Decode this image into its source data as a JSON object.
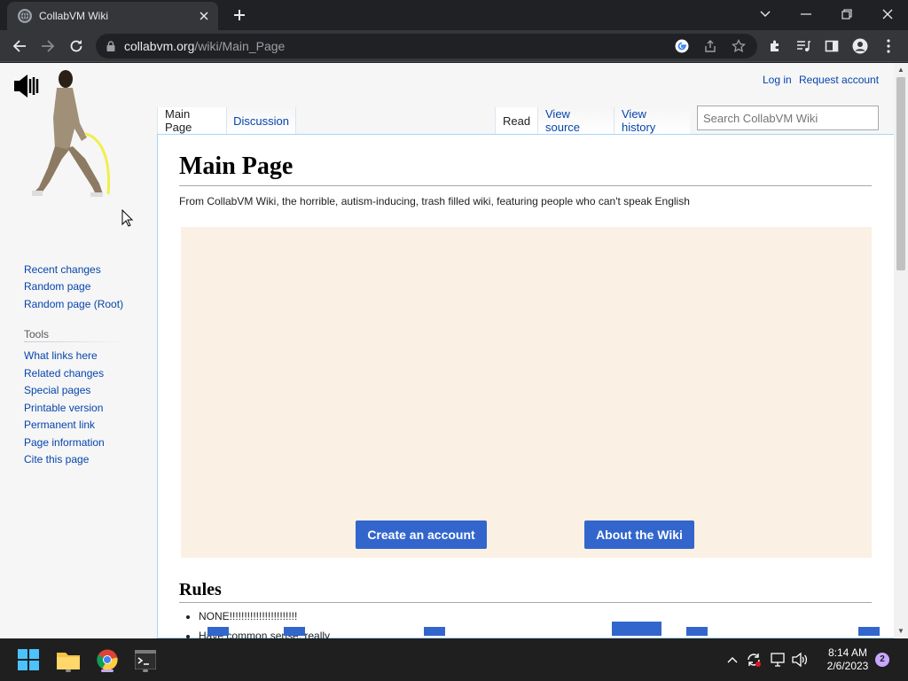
{
  "browser": {
    "tab_title": "CollabVM Wiki",
    "url_host": "collabvm.org",
    "url_path": "/wiki/Main_Page"
  },
  "wiki": {
    "personal": {
      "login": "Log in",
      "request": "Request account"
    },
    "namespaces": {
      "main": "Main Page",
      "discussion": "Discussion"
    },
    "views": {
      "read": "Read",
      "source": "View source",
      "history": "View history"
    },
    "search_placeholder": "Search CollabVM Wiki",
    "nav": [
      "Recent changes",
      "Random page",
      "Random page (Root)"
    ],
    "tools_heading": "Tools",
    "tools": [
      "What links here",
      "Related changes",
      "Special pages",
      "Printable version",
      "Permanent link",
      "Page information",
      "Cite this page"
    ],
    "title": "Main Page",
    "tagline": "From CollabVM Wiki, the horrible, autism-inducing, trash filled wiki, featuring people who can't speak English",
    "btn_create": "Create an account",
    "btn_about": "About the Wiki",
    "rules_heading": "Rules",
    "rules": [
      "NONE!!!!!!!!!!!!!!!!!!!!!!!",
      "Have common sense, really"
    ]
  },
  "taskbar": {
    "time": "8:14 AM",
    "date": "2/6/2023",
    "notifications": "2"
  },
  "colors": {
    "link": "#0645ad",
    "button": "#3366cc",
    "banner": "#fbf0e4"
  }
}
